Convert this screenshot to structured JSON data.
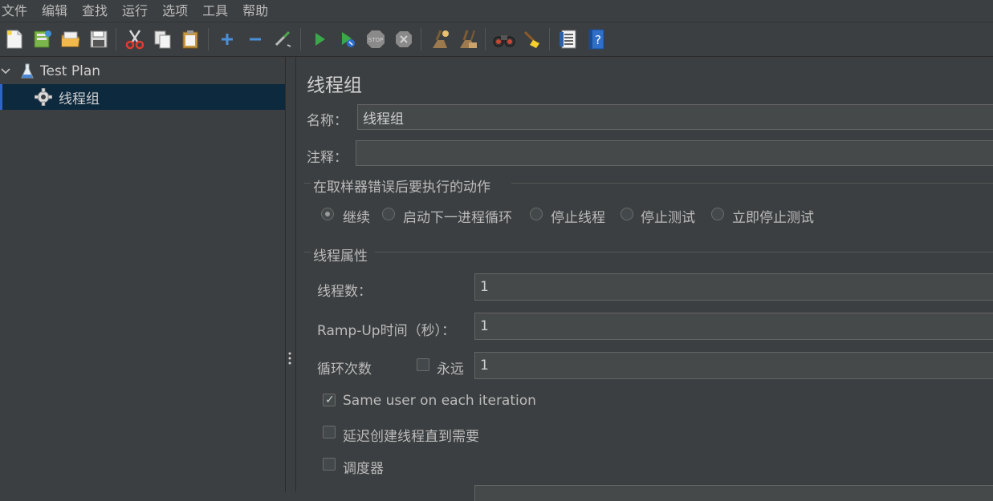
{
  "menu": [
    "文件",
    "编辑",
    "查找",
    "运行",
    "选项",
    "工具",
    "帮助"
  ],
  "toolbar": {
    "icons": [
      "new-icon",
      "templates-icon",
      "open-icon",
      "save-icon",
      "cut-icon",
      "copy-icon",
      "paste-icon",
      "expand-icon",
      "collapse-icon",
      "toggle-icon",
      "start-icon",
      "start-no-pauses-icon",
      "stop-icon",
      "shutdown-icon",
      "clear-icon",
      "clear-all-icon",
      "search-icon",
      "reset-search-icon",
      "function-helper-icon",
      "help-icon"
    ]
  },
  "tree": {
    "root": "Test Plan",
    "child": "线程组"
  },
  "panel": {
    "title": "线程组",
    "name_label": "名称：",
    "name_value": "线程组",
    "comment_label": "注释：",
    "comment_value": "",
    "error_action_group": "在取样器错误后要执行的动作",
    "error_actions": [
      "继续",
      "启动下一进程循环",
      "停止线程",
      "停止测试",
      "立即停止测试"
    ],
    "error_action_selected": 0,
    "thread_props_group": "线程属性",
    "threads_label": "线程数：",
    "threads_value": "1",
    "rampup_label": "Ramp-Up时间（秒）：",
    "rampup_value": "1",
    "loop_label": "循环次数",
    "forever_label": "永远",
    "forever_checked": false,
    "loop_value": "1",
    "same_user_label": "Same user on each iteration",
    "same_user_checked": true,
    "delay_label": "延迟创建线程直到需要",
    "delay_checked": false,
    "scheduler_label": "调度器",
    "scheduler_checked": false
  }
}
